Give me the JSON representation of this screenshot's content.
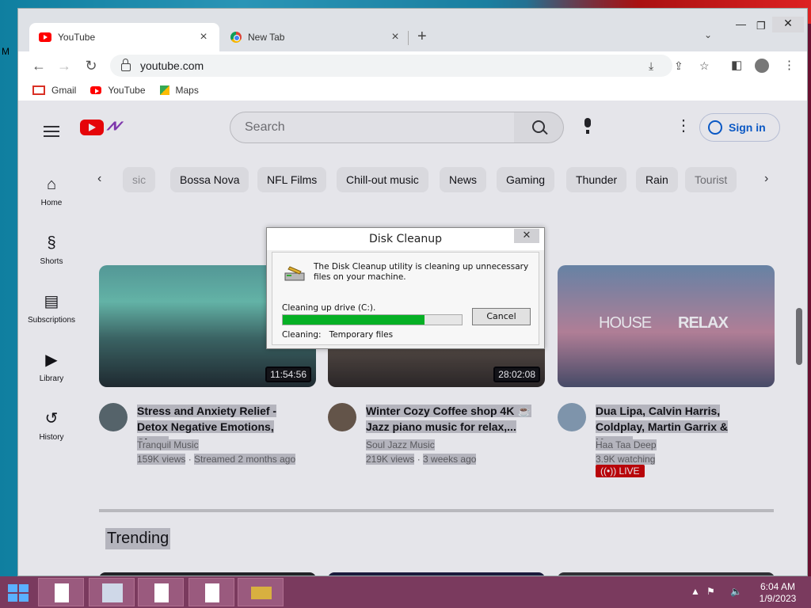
{
  "desktop": {
    "side_label": "M"
  },
  "browser": {
    "tabs": [
      {
        "label": "YouTube",
        "icon": "youtube-favicon"
      },
      {
        "label": "New Tab",
        "icon": "chrome-favicon"
      }
    ],
    "address": "youtube.com",
    "bookmarks": [
      {
        "label": "Gmail",
        "icon": "gmail-icon"
      },
      {
        "label": "YouTube",
        "icon": "youtube-icon"
      },
      {
        "label": "Maps",
        "icon": "maps-icon"
      }
    ]
  },
  "youtube": {
    "search_placeholder": "Search",
    "sign_in": "Sign in",
    "sidebar": [
      {
        "label": "Home",
        "icon": "home-icon"
      },
      {
        "label": "Shorts",
        "icon": "shorts-icon"
      },
      {
        "label": "Subscriptions",
        "icon": "subscriptions-icon"
      },
      {
        "label": "Library",
        "icon": "library-icon"
      },
      {
        "label": "History",
        "icon": "history-icon"
      }
    ],
    "chips": [
      "sic",
      "Bossa Nova",
      "NFL Films",
      "Chill-out music",
      "News",
      "Gaming",
      "Thunder",
      "Rain",
      "Tourist"
    ],
    "videos": [
      {
        "duration": "11:54:56",
        "title_line1": "Stress and Anxiety Relief -",
        "title_line2": "Detox Negative Emotions, Slee...",
        "channel": "Tranquil Music",
        "views": "159K views",
        "age": "Streamed 2 months ago"
      },
      {
        "duration": "28:02:08",
        "title_line1": "Winter Cozy Coffee shop 4K ☕",
        "title_line2": "Jazz piano music for relax,...",
        "channel": "Soul Jazz Music",
        "views": "219K views",
        "age": "3 weeks ago"
      },
      {
        "thumb_text_left": "HOUSE",
        "thumb_text_right": "RELAX",
        "title_line1": "Dua Lipa, Calvin Harris,",
        "title_line2": "Coldplay, Martin Garrix & Kygo...",
        "channel": "Haa Taa Deep",
        "views": "3.9K watching",
        "live": "LIVE"
      }
    ],
    "trending": "Trending"
  },
  "dialog": {
    "title": "Disk Cleanup",
    "message": "The Disk Cleanup utility is cleaning up unnecessary files on your machine.",
    "drive_text": "Cleaning up drive  (C:).",
    "progress": 0.79,
    "cancel": "Cancel",
    "cleaning_label": "Cleaning:",
    "cleaning_item": "Temporary files"
  },
  "taskbar": {
    "time": "6:04 AM",
    "date": "1/9/2023"
  }
}
